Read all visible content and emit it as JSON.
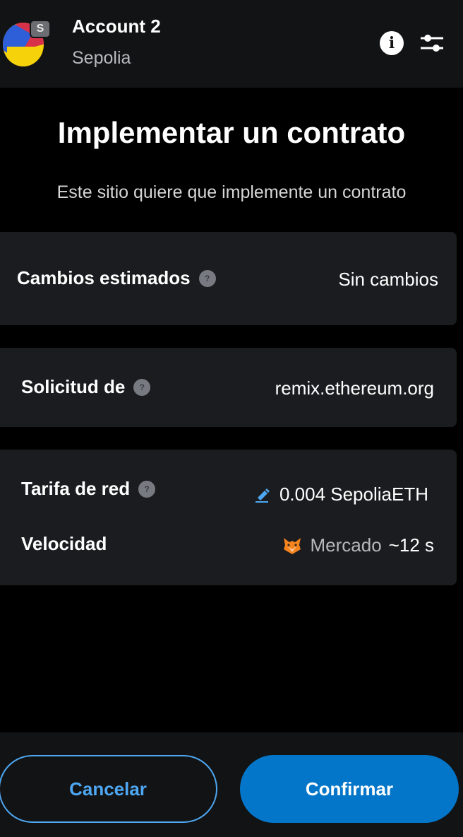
{
  "header": {
    "account_name": "Account 2",
    "network": "Sepolia",
    "badge": "S",
    "icons": {
      "info": "info-icon",
      "settings": "settings-sliders-icon"
    }
  },
  "main": {
    "title": "Implementar un contrato",
    "subtitle": "Este sitio quiere que implemente un contrato"
  },
  "estimated_changes": {
    "label": "Cambios estimados",
    "value": "Sin cambios"
  },
  "request": {
    "label": "Solicitud de",
    "value": "remix.ethereum.org"
  },
  "network_fee": {
    "label": "Tarifa de red",
    "value": "0.004 SepoliaETH",
    "speed_label": "Velocidad",
    "speed_value": "Mercado",
    "speed_time": "~12 s"
  },
  "footer": {
    "cancel_label": "Cancelar",
    "confirm_label": "Confirmar"
  },
  "colors": {
    "background": "#000000",
    "panel": "#1b1c1f",
    "header": "#121314",
    "accent": "#0376c9",
    "accent_outline": "#4ea7f2"
  }
}
